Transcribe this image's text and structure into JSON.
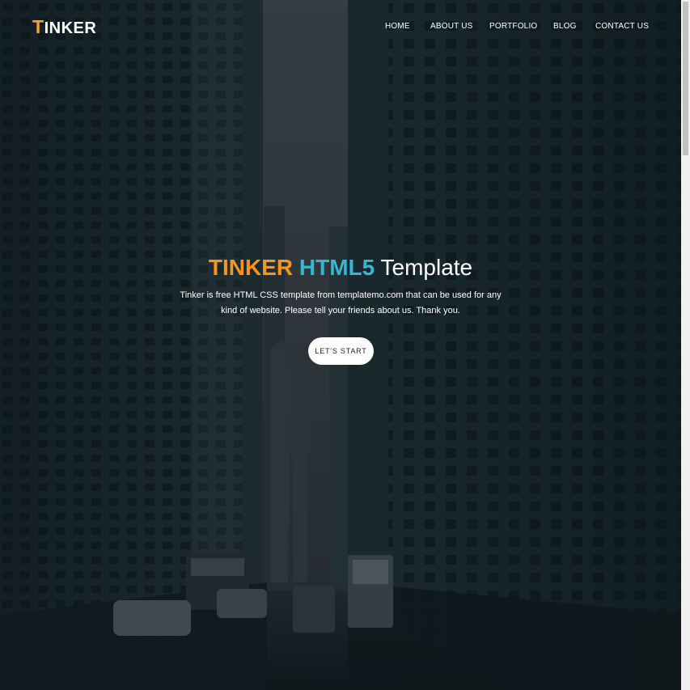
{
  "header": {
    "logo_first": "T",
    "logo_rest": "INKER",
    "nav": [
      "HOME",
      "ABOUT US",
      "PORTFOLIO",
      "BLOG",
      "CONTACT US"
    ]
  },
  "hero": {
    "title_part1": "TINKER",
    "title_part2": "HTML5",
    "title_part3": "Template",
    "description": "Tinker is free HTML CSS template from templatemo.com that can be used for any kind of website. Please tell your friends about us. Thank you.",
    "cta_label": "LET'S START"
  },
  "colors": {
    "accent_orange": "#f7941d",
    "accent_cyan": "#35b6d0",
    "overlay": "#0d1a1f"
  }
}
